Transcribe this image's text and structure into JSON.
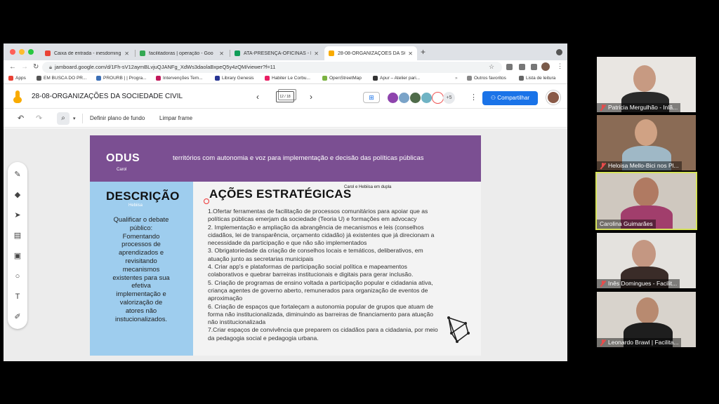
{
  "browser": {
    "tabs": [
      {
        "label": "Caixa de entrada - inesdoming",
        "color": "#ea4335"
      },
      {
        "label": "facilitadoras | operação - Goo",
        "color": "#34a853"
      },
      {
        "label": "ATA-PRESENÇA-OFICINAS - P",
        "color": "#0f9d58"
      },
      {
        "label": "28-08-ORGANIZAÇÕES DA SO",
        "color": "#f9ab00"
      }
    ],
    "url": "jamboard.google.com/d/1Fh-sV12aymBLvjuQJANFg_XdWs3daolaBxpeQ5y4zQM/viewer?f=11",
    "bookmarks": [
      {
        "label": "Apps",
        "color": "#e94235"
      },
      {
        "label": "EM BUSCA DO PR...",
        "color": "#555555"
      },
      {
        "label": "PROURB | | Progra...",
        "color": "#3b6fb6"
      },
      {
        "label": "Intervenções Tem...",
        "color": "#c2185b"
      },
      {
        "label": "Library Genesis",
        "color": "#283593"
      },
      {
        "label": "Habiter Le Corbu...",
        "color": "#e91e63"
      },
      {
        "label": "OpenStreetMap",
        "color": "#7cb342"
      },
      {
        "label": "Apur – Atelier pari...",
        "color": "#333333"
      }
    ],
    "bookmarks_right": [
      {
        "label": "Outros favoritos"
      },
      {
        "label": "Lista de leitura"
      }
    ]
  },
  "jamboard": {
    "title": "28-08-ORGANIZAÇÕES DA SOCIEDADE CIVIL",
    "frame_indicator": "12 / 18",
    "avatars_more": "+5",
    "share_label": "Compartilhar",
    "toolbar": {
      "set_background": "Definir plano de fundo",
      "clear_frame": "Limpar frame"
    }
  },
  "slide": {
    "heading": "ODUS",
    "heading_author": "Carol",
    "subtitle": "territórios com autonomia e voz para implementação e decisão das políticas públicas",
    "description_title": "DESCRIÇÃO",
    "description_author": "Hebiisa",
    "description_text": "Qualificar o debate\npúblico:\nFomentando\nprocessos de\naprendizados e\nrevisitando\nmecanismos\nexistentes para sua\nefetiva\nimplementação e\nvalorização de\natores não\ninstucionalizados.",
    "actions_title": "AÇÕES ESTRATÉGICAS",
    "actions_author": "Carol e Hebiisa em dupla",
    "actions_text": "1.Ofertar ferramentas de facilitação de processos comunitários para apoiar que as\npolíticas públicas emerjam da sociedade (Teoria U) e formações em advocacy\n2. Implementação e ampliação da abrangência de mecanismos e leis (conselhos\ncidadãos, lei de transparência, orçamento cidadão) já existentes que já direcionam a\nnecessidade da participação e que não são implementados\n3. Obrigatoriedade da criação de conselhos locais e temáticos, deliberativos, em\natuação junto as secretarias municipais\n4. Criar app's e plataformas de participação social política e mapeamentos\ncolaborativos e quebrar barreiras institucionais e digitais para gerar inclusão.\n5. Criação de programas de ensino voltada a participação popular e cidadania ativa,\ncriança agentes de governo aberto, remunerados para organização de eventos de\naproximação\n6. Criação de espaços que fortaleçam a autonomia popular de grupos que atuam de\nforma não institucionalizada, diminuindo as barreiras de financiamento para atuação\nnão institucionalizada\n7.Criar espaços de convivência que preparem os cidadãos para a cidadania, por meio\nda pedagogia social e pedagogia urbana."
  },
  "participants": [
    {
      "name": "Patricia Mergulhão - Inlã...",
      "muted": true
    },
    {
      "name": "Heloisa Mello-Bici nos Pl...",
      "muted": true
    },
    {
      "name": "Carolina Guimarães",
      "muted": false,
      "speaking": true
    },
    {
      "name": "Inês Domingues - Facilit...",
      "muted": true
    },
    {
      "name": "Leonardo Brawl | Facilita...",
      "muted": true
    }
  ]
}
